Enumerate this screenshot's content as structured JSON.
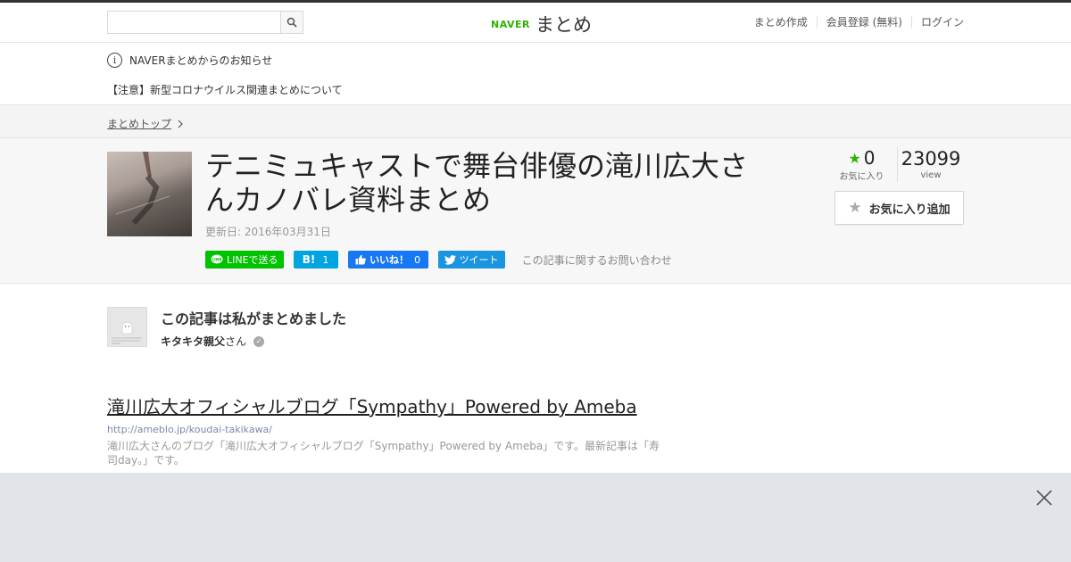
{
  "header": {
    "search_placeholder": "",
    "logo_brand": "NAVER",
    "logo_name": "まとめ",
    "nav": [
      "まとめ作成",
      "会員登録 (無料)",
      "ログイン"
    ]
  },
  "notice": {
    "info": "NAVERまとめからのお知らせ",
    "item": "【注意】新型コロナウイルス関連まとめについて"
  },
  "breadcrumb": {
    "top": "まとめトップ"
  },
  "article": {
    "title": "テニミュキャストで舞台俳優の滝川広大さんカノバレ資料まとめ",
    "updated": "更新日: 2016年03月31日",
    "share": {
      "line": "LINEで送る",
      "hatena_count": "1",
      "fb_label": "いいね！",
      "fb_count": "0",
      "tweet": "ツイート"
    },
    "inquiry": "この記事に関するお問い合わせ",
    "favorites": "0",
    "favorites_label": "お気に入り",
    "views": "23099",
    "views_label": "view",
    "fav_button": "お気に入り追加"
  },
  "author": {
    "heading": "この記事は私がまとめました",
    "name": "キタキタ親父",
    "suffix": "さん"
  },
  "link": {
    "title": "滝川広大オフィシャルブログ「Sympathy」Powered by Ameba",
    "url": "http://ameblo.jp/koudai-takikawa/",
    "desc": "滝川広大さんのブログ「滝川広大オフィシャルブログ「Sympathy」Powered by Ameba」です。最新記事は「寿司day。」です。"
  },
  "colors": {
    "brand_green": "#2db400",
    "line_green": "#00c300",
    "facebook": "#1877f2",
    "twitter": "#1b95e0",
    "hatena": "#00a4de"
  }
}
